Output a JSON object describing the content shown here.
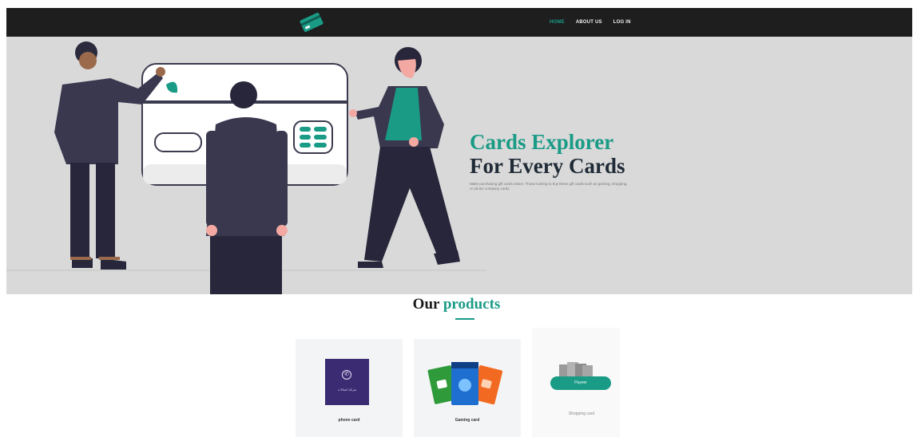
{
  "nav": {
    "logo_icon": "credit-card-logo",
    "links": [
      {
        "label": "HOME",
        "active": true
      },
      {
        "label": "ABOUT US",
        "active": false
      },
      {
        "label": "LOG IN",
        "active": false
      }
    ]
  },
  "hero": {
    "title_line1": "Cards Explorer",
    "title_line2": "For Every Cards",
    "description": "Make purchasing gift cards easier. Those looking to buy these gift cards such as gaming, shopping, or phone company cards"
  },
  "products": {
    "title_word1": "Our",
    "title_word2": "products",
    "items": [
      {
        "label": "phone card",
        "image_text": "شركة اتصالات"
      },
      {
        "label": "Gaming card"
      },
      {
        "label": "Shopping card",
        "button": "Payeer"
      }
    ]
  },
  "colors": {
    "accent": "#1a9b86",
    "navbar": "#1e1e1e",
    "hero_bg": "#d9d9d9",
    "heading_dark": "#1f2a36"
  }
}
